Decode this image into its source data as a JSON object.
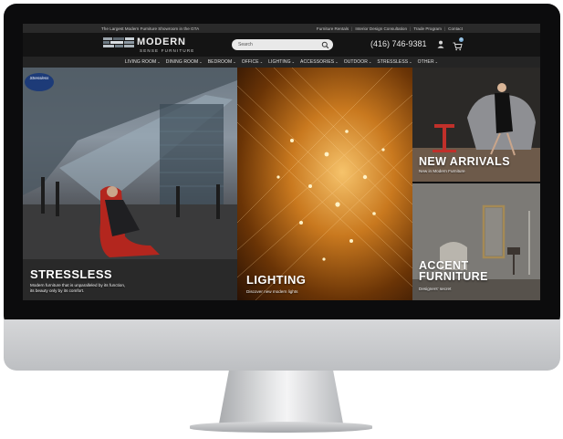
{
  "topbar": {
    "tagline": "The Largest Modern Furniture Showroom in the GTA",
    "links": [
      "Furniture Rentals",
      "Interior Design Consultation",
      "Trade Program",
      "Contact"
    ]
  },
  "header": {
    "logo_word": "MODERN",
    "logo_sub": "SENSE FURNITURE",
    "search_placeholder": "Search",
    "phone": "(416) 746-9381",
    "cart_count": "0",
    "icons": [
      "search-icon",
      "user-icon",
      "cart-icon"
    ]
  },
  "nav": {
    "items": [
      "LIVING ROOM",
      "DINING ROOM",
      "BEDROOM",
      "OFFICE",
      "LIGHTING",
      "ACCESSORIES",
      "OUTDOOR",
      "STRESSLESS",
      "OTHER"
    ]
  },
  "panels": {
    "stressless": {
      "badge": "Stressless",
      "title": "STRESSLESS",
      "subtitle": "Modern furniture that is unparalleled by its function, its beauty only by its comfort."
    },
    "lighting": {
      "title": "LIGHTING",
      "subtitle": "Discover new modern lights"
    },
    "new_arrivals": {
      "title": "NEW ARRIVALS",
      "subtitle": "New in Modern Furniture"
    },
    "accent": {
      "title": "ACCENT FURNITURE",
      "subtitle": "Designers' secret"
    }
  },
  "colors": {
    "page_bg": "#ffffff",
    "bezel": "#0c0c0d",
    "topbar_bg": "#2a2a2a",
    "header_bg": "#141414",
    "nav_bg": "#242424",
    "cart_badge": "#7db0d8"
  }
}
